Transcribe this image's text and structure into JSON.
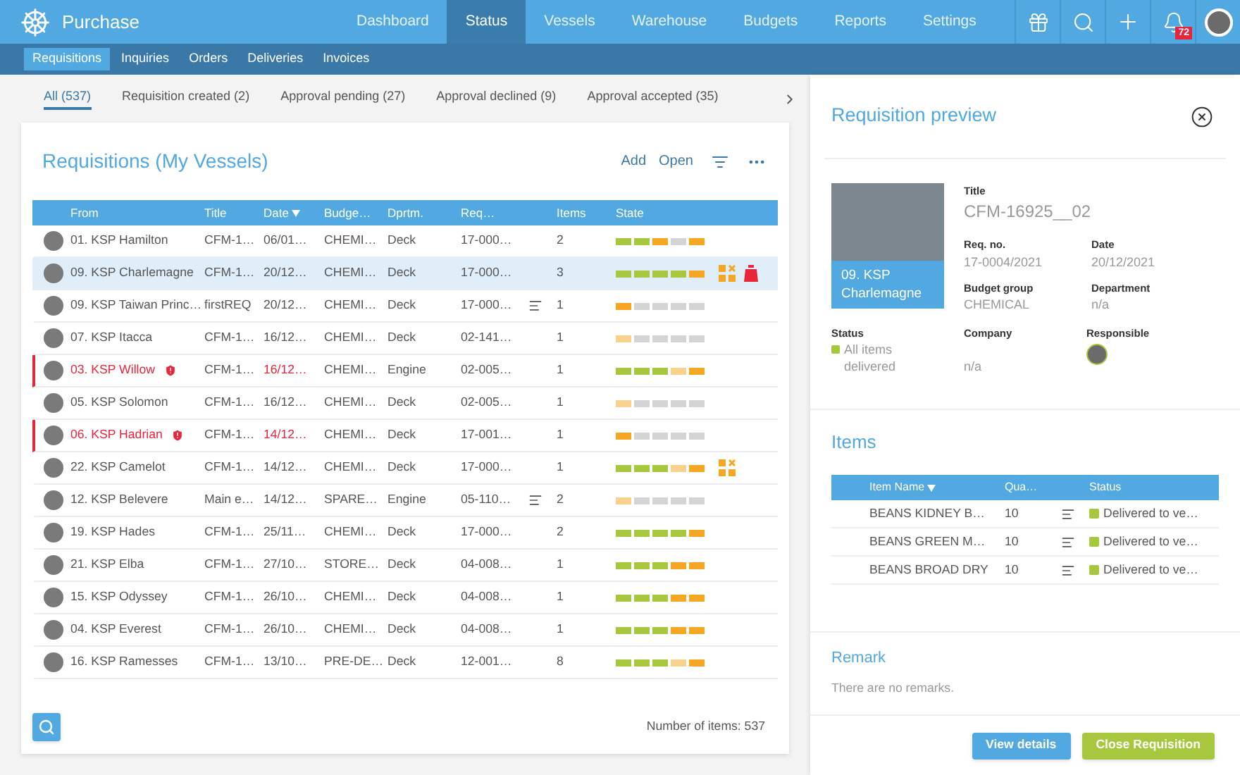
{
  "app": {
    "title": "Purchase"
  },
  "nav": [
    {
      "label": "Dashboard",
      "selected": false
    },
    {
      "label": "Status",
      "selected": true
    },
    {
      "label": "Vessels",
      "selected": false
    },
    {
      "label": "Warehouse",
      "selected": false
    },
    {
      "label": "Budgets",
      "selected": false
    },
    {
      "label": "Reports",
      "selected": false
    },
    {
      "label": "Settings",
      "selected": false
    }
  ],
  "toolbar": [
    {
      "kind": "gift"
    },
    {
      "kind": "search"
    },
    {
      "kind": "add"
    },
    {
      "kind": "bell",
      "badge": "72"
    },
    {
      "kind": "avatar"
    }
  ],
  "subnav": [
    {
      "label": "Requisitions",
      "selected": true
    },
    {
      "label": "Inquiries",
      "selected": false
    },
    {
      "label": "Orders",
      "selected": false
    },
    {
      "label": "Deliveries",
      "selected": false
    },
    {
      "label": "Invoices",
      "selected": false
    }
  ],
  "filter_tabs": [
    {
      "label": "All (537)",
      "selected": true
    },
    {
      "label": "Requisition created (2)",
      "selected": false
    },
    {
      "label": "Approval pending (27)",
      "selected": false
    },
    {
      "label": "Approval declined (9)",
      "selected": false
    },
    {
      "label": "Approval accepted (35)",
      "selected": false
    }
  ],
  "list": {
    "title": "Requisitions (My Vessels)",
    "actions": [
      "Add",
      "Open"
    ],
    "columns": [
      {
        "label": "From",
        "sorted": false
      },
      {
        "label": "Title",
        "sorted": false
      },
      {
        "label": "Date",
        "sorted": true
      },
      {
        "label": "Budge…",
        "sorted": false
      },
      {
        "label": "Dprtm.",
        "sorted": false
      },
      {
        "label": "Req…",
        "sorted": false
      },
      {
        "label": "Items",
        "sorted": false
      },
      {
        "label": "State",
        "sorted": false
      }
    ],
    "rows": [
      {
        "from": "01. KSP Hamilton",
        "title": "CFM-1…",
        "date": "06/01…",
        "budget": "CHEMI…",
        "dept": "Deck",
        "req": "17-000…",
        "items": "2",
        "selected": false,
        "alert": false,
        "note": false,
        "state": [
          {
            "color": "#a7c83e"
          },
          {
            "color": "#a7c83e"
          },
          {
            "color": "#f5a623"
          },
          {
            "color": "#d4d4d4"
          },
          {
            "color": "#f5a623"
          }
        ],
        "flags": []
      },
      {
        "from": "09. KSP Charlemagne",
        "title": "CFM-1…",
        "date": "20/12…",
        "budget": "CHEMI…",
        "dept": "Deck",
        "req": "17-000…",
        "items": "3",
        "selected": true,
        "alert": false,
        "note": false,
        "state": [
          {
            "color": "#a7c83e"
          },
          {
            "color": "#a7c83e"
          },
          {
            "color": "#a7c83e"
          },
          {
            "color": "#a7c83e"
          },
          {
            "color": "#f5a623"
          }
        ],
        "flags": [
          {
            "kind": "grid"
          },
          {
            "kind": "bag"
          }
        ]
      },
      {
        "from": "09. KSP Taiwan Princ…",
        "title": "firstREQ",
        "date": "20/12…",
        "budget": "CHEMI…",
        "dept": "Deck",
        "req": "17-000…",
        "items": "1",
        "selected": false,
        "alert": false,
        "note": true,
        "state": [
          {
            "color": "#f5a623"
          },
          {
            "color": "#d4d4d4"
          },
          {
            "color": "#d4d4d4"
          },
          {
            "color": "#d4d4d4"
          },
          {
            "color": "#d4d4d4"
          }
        ],
        "flags": []
      },
      {
        "from": "07. KSP Itacca",
        "title": "CFM-1…",
        "date": "16/12…",
        "budget": "CHEMI…",
        "dept": "Deck",
        "req": "02-141…",
        "items": "1",
        "selected": false,
        "alert": false,
        "note": false,
        "state": [
          {
            "color": "#f9d18f"
          },
          {
            "color": "#d4d4d4"
          },
          {
            "color": "#d4d4d4"
          },
          {
            "color": "#d4d4d4"
          },
          {
            "color": "#d4d4d4"
          }
        ],
        "flags": []
      },
      {
        "from": "03. KSP Willow",
        "title": "CFM-1…",
        "date": "16/12…",
        "budget": "CHEMI…",
        "dept": "Engine",
        "req": "02-005…",
        "items": "1",
        "selected": false,
        "alert": true,
        "note": false,
        "state": [
          {
            "color": "#a7c83e"
          },
          {
            "color": "#a7c83e"
          },
          {
            "color": "#a7c83e"
          },
          {
            "color": "#f9d18f"
          },
          {
            "color": "#f5a623"
          }
        ],
        "flags": []
      },
      {
        "from": "05. KSP Solomon",
        "title": "CFM-1…",
        "date": "16/12…",
        "budget": "CHEMI…",
        "dept": "Deck",
        "req": "02-005…",
        "items": "1",
        "selected": false,
        "alert": false,
        "note": false,
        "state": [
          {
            "color": "#f9d18f"
          },
          {
            "color": "#d4d4d4"
          },
          {
            "color": "#d4d4d4"
          },
          {
            "color": "#d4d4d4"
          },
          {
            "color": "#d4d4d4"
          }
        ],
        "flags": []
      },
      {
        "from": "06. KSP Hadrian",
        "title": "CFM-1…",
        "date": "14/12…",
        "budget": "CHEMI…",
        "dept": "Deck",
        "req": "17-001…",
        "items": "1",
        "selected": false,
        "alert": true,
        "note": false,
        "state": [
          {
            "color": "#f5a623"
          },
          {
            "color": "#d4d4d4"
          },
          {
            "color": "#d4d4d4"
          },
          {
            "color": "#d4d4d4"
          },
          {
            "color": "#d4d4d4"
          }
        ],
        "flags": []
      },
      {
        "from": "22. KSP Camelot",
        "title": "CFM-1…",
        "date": "14/12…",
        "budget": "CHEMI…",
        "dept": "Deck",
        "req": "17-000…",
        "items": "1",
        "selected": false,
        "alert": false,
        "note": false,
        "state": [
          {
            "color": "#a7c83e"
          },
          {
            "color": "#a7c83e"
          },
          {
            "color": "#a7c83e"
          },
          {
            "color": "#f9d18f"
          },
          {
            "color": "#f5a623"
          }
        ],
        "flags": [
          {
            "kind": "grid"
          }
        ]
      },
      {
        "from": "12. KSP Belevere",
        "title": "Main e…",
        "date": "14/12…",
        "budget": "SPARE…",
        "dept": "Engine",
        "req": "05-110…",
        "items": "2",
        "selected": false,
        "alert": false,
        "note": true,
        "state": [
          {
            "color": "#f9d18f"
          },
          {
            "color": "#d4d4d4"
          },
          {
            "color": "#d4d4d4"
          },
          {
            "color": "#d4d4d4"
          },
          {
            "color": "#d4d4d4"
          }
        ],
        "flags": []
      },
      {
        "from": "19. KSP Hades",
        "title": "CFM-1…",
        "date": "25/11…",
        "budget": "CHEMI…",
        "dept": "Deck",
        "req": "17-000…",
        "items": "2",
        "selected": false,
        "alert": false,
        "note": false,
        "state": [
          {
            "color": "#a7c83e"
          },
          {
            "color": "#a7c83e"
          },
          {
            "color": "#a7c83e"
          },
          {
            "color": "#a7c83e"
          },
          {
            "color": "#f5a623"
          }
        ],
        "flags": []
      },
      {
        "from": "21. KSP Elba",
        "title": "CFM-1…",
        "date": "27/10…",
        "budget": "STORE…",
        "dept": "Deck",
        "req": "04-008…",
        "items": "1",
        "selected": false,
        "alert": false,
        "note": false,
        "state": [
          {
            "color": "#a7c83e"
          },
          {
            "color": "#a7c83e"
          },
          {
            "color": "#a7c83e"
          },
          {
            "color": "#f5a623"
          },
          {
            "color": "#f5a623"
          }
        ],
        "flags": []
      },
      {
        "from": "15. KSP Odyssey",
        "title": "CFM-1…",
        "date": "26/10…",
        "budget": "CHEMI…",
        "dept": "Deck",
        "req": "04-008…",
        "items": "1",
        "selected": false,
        "alert": false,
        "note": false,
        "state": [
          {
            "color": "#a7c83e"
          },
          {
            "color": "#a7c83e"
          },
          {
            "color": "#a7c83e"
          },
          {
            "color": "#f5a623"
          },
          {
            "color": "#f5a623"
          }
        ],
        "flags": []
      },
      {
        "from": "04. KSP Everest",
        "title": "CFM-1…",
        "date": "26/10…",
        "budget": "CHEMI…",
        "dept": "Deck",
        "req": "04-008…",
        "items": "1",
        "selected": false,
        "alert": false,
        "note": false,
        "state": [
          {
            "color": "#a7c83e"
          },
          {
            "color": "#a7c83e"
          },
          {
            "color": "#a7c83e"
          },
          {
            "color": "#f5a623"
          },
          {
            "color": "#f5a623"
          }
        ],
        "flags": []
      },
      {
        "from": "16. KSP Ramesses",
        "title": "CFM-1…",
        "date": "13/10…",
        "budget": "PRE-DE…",
        "dept": "Deck",
        "req": "12-001…",
        "items": "8",
        "selected": false,
        "alert": false,
        "note": false,
        "state": [
          {
            "color": "#a7c83e"
          },
          {
            "color": "#a7c83e"
          },
          {
            "color": "#a7c83e"
          },
          {
            "color": "#f9d18f"
          },
          {
            "color": "#f5a623"
          }
        ],
        "flags": []
      }
    ],
    "count": "Number of items: 537"
  },
  "preview": {
    "heading": "Requisition preview",
    "vessel": "09. KSP Charlemagne",
    "title_field": {
      "label": "Title",
      "value": "CFM-16925__02"
    },
    "fields": [
      {
        "label": "Req. no.",
        "value": "17-0004/2021"
      },
      {
        "label": "Date",
        "value": "20/12/2021"
      },
      {
        "label": "Budget group",
        "value": "CHEMICAL"
      },
      {
        "label": "Department",
        "value": "n/a"
      }
    ],
    "status": {
      "label": "Status",
      "value": "All items delivered",
      "color": "#a7c83e"
    },
    "company": {
      "label": "Company",
      "value": "n/a"
    },
    "responsible": {
      "label": "Responsible"
    },
    "items": {
      "title": "Items",
      "columns": [
        {
          "label": "Item Name",
          "sorted": true
        },
        {
          "label": "Qua…",
          "sorted": false
        },
        {
          "label": "Status",
          "sorted": false
        }
      ],
      "rows": [
        {
          "name": "BEANS KIDNEY B…",
          "qty": "10",
          "note": true,
          "status": "Delivered to ve…",
          "color": "#a7c83e"
        },
        {
          "name": "BEANS GREEN M…",
          "qty": "10",
          "note": true,
          "status": "Delivered to ve…",
          "color": "#a7c83e"
        },
        {
          "name": "BEANS BROAD DRY",
          "qty": "10",
          "note": true,
          "status": "Delivered to ve…",
          "color": "#a7c83e"
        }
      ]
    },
    "remark": {
      "title": "Remark",
      "text": "There are no remarks."
    },
    "buttons": [
      {
        "label": "View details",
        "kind": "primary"
      },
      {
        "label": "Close Requisition",
        "kind": "success"
      }
    ]
  }
}
